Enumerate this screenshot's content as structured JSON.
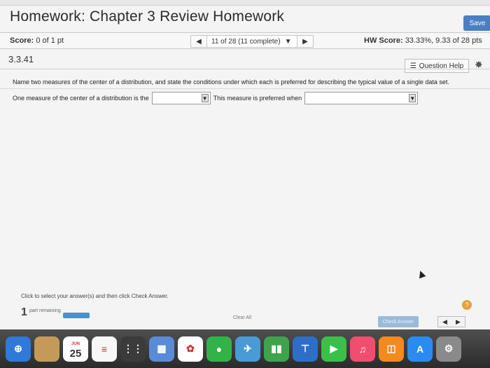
{
  "app": {
    "title": "Homework: Chapter 3 Review Homework",
    "save_label": "Save"
  },
  "score_bar": {
    "score_label": "Score:",
    "score_value": "0 of 1 pt",
    "nav_position": "11 of 28 (11 complete)",
    "hw_score_label": "HW Score:",
    "hw_score_value": "33.33%, 9.33 of 28 pts"
  },
  "question": {
    "number": "3.3.41",
    "help_label": "Question Help",
    "prompt": "Name two measures of the center of a distribution, and state the conditions under which each is preferred for describing the typical value of a single data set.",
    "answer_prefix": "One measure of the center of a distribution is the",
    "answer_middle": "This measure is preferred when",
    "dropdown_1_value": "",
    "dropdown_2_value": ""
  },
  "footer": {
    "instruction": "Click to select your answer(s) and then click Check Answer.",
    "parts_count": "1",
    "parts_label": "part remaining",
    "clear_all": "Clear All",
    "check_answer": "Check Answer",
    "progress_fraction": 1.0
  },
  "dock": {
    "items": [
      {
        "name": "safari-icon",
        "color": "#2f7ad6",
        "glyph": "⊕"
      },
      {
        "name": "notes-icon",
        "color": "#c49a5b",
        "glyph": ""
      },
      {
        "name": "calendar-icon",
        "color": "#ffffff",
        "glyph": "25",
        "month": "JUN"
      },
      {
        "name": "reminders-icon",
        "color": "#f7f7f7",
        "glyph": "≡"
      },
      {
        "name": "launchpad-icon",
        "color": "#3b3b3b",
        "glyph": "⋮⋮"
      },
      {
        "name": "photos-app-icon",
        "color": "#5a8bd6",
        "glyph": "▦"
      },
      {
        "name": "photos-icon",
        "color": "#ffffff",
        "glyph": "✿"
      },
      {
        "name": "messages-icon",
        "color": "#32b34a",
        "glyph": "●"
      },
      {
        "name": "maps-icon",
        "color": "#4a9ad6",
        "glyph": "✈"
      },
      {
        "name": "numbers-icon",
        "color": "#3fa34d",
        "glyph": "▮▮"
      },
      {
        "name": "keynote-icon",
        "color": "#2d6fc7",
        "glyph": "⊤"
      },
      {
        "name": "facetime-icon",
        "color": "#3abf4b",
        "glyph": "▶"
      },
      {
        "name": "music-icon",
        "color": "#f04e6f",
        "glyph": "♫"
      },
      {
        "name": "books-icon",
        "color": "#f28a1e",
        "glyph": "◫"
      },
      {
        "name": "app-store-icon",
        "color": "#2a8cf0",
        "glyph": "A"
      },
      {
        "name": "settings-icon",
        "color": "#8a8a8a",
        "glyph": "⚙"
      }
    ]
  }
}
